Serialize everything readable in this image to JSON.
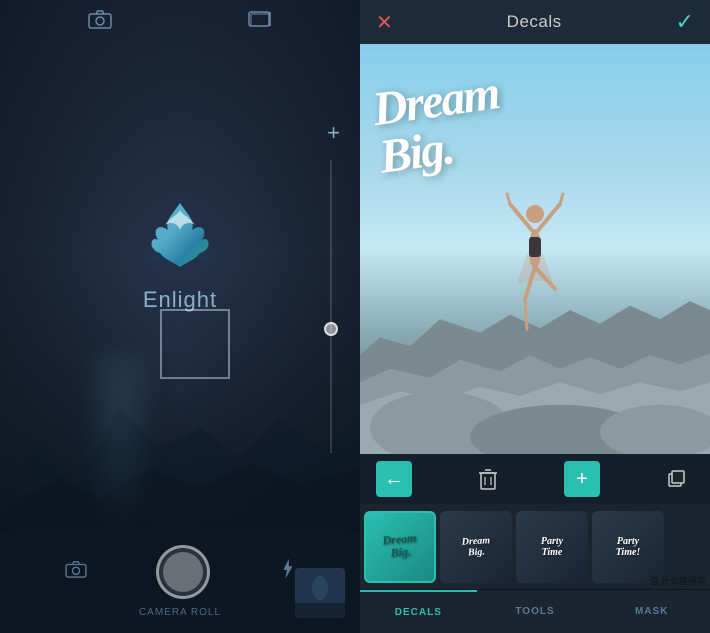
{
  "left": {
    "appName": "Enlight",
    "topIcons": [
      "📷",
      "🗂"
    ],
    "addLabel": "+",
    "bottomBar": {
      "icons": [
        "📷",
        "⚡"
      ],
      "shutterLabel": "",
      "cameraRollLabel": "CAMERA ROLL"
    }
  },
  "right": {
    "header": {
      "closeIcon": "✕",
      "title": "Decals",
      "checkIcon": "✓"
    },
    "dreamBigText": "Dream\nBig.",
    "toolbar": {
      "backIcon": "←",
      "deleteIcon": "🗑",
      "addIcon": "+",
      "duplicateIcon": "⧉"
    },
    "decals": [
      {
        "id": 1,
        "label": "Dream\nBig.",
        "style": "teal",
        "active": true
      },
      {
        "id": 2,
        "label": "Dream\nBig.",
        "style": "white",
        "active": false
      },
      {
        "id": 3,
        "label": "Party\nTime",
        "style": "white",
        "active": false
      },
      {
        "id": 4,
        "label": "Party\nTime!",
        "style": "white",
        "active": false
      }
    ],
    "tabs": [
      {
        "id": "decals",
        "label": "DECALS",
        "active": true
      },
      {
        "id": "tools",
        "label": "TOOLS",
        "active": false
      },
      {
        "id": "mask",
        "label": "MASK",
        "active": false
      }
    ],
    "watermark": "值 什么值得买"
  }
}
